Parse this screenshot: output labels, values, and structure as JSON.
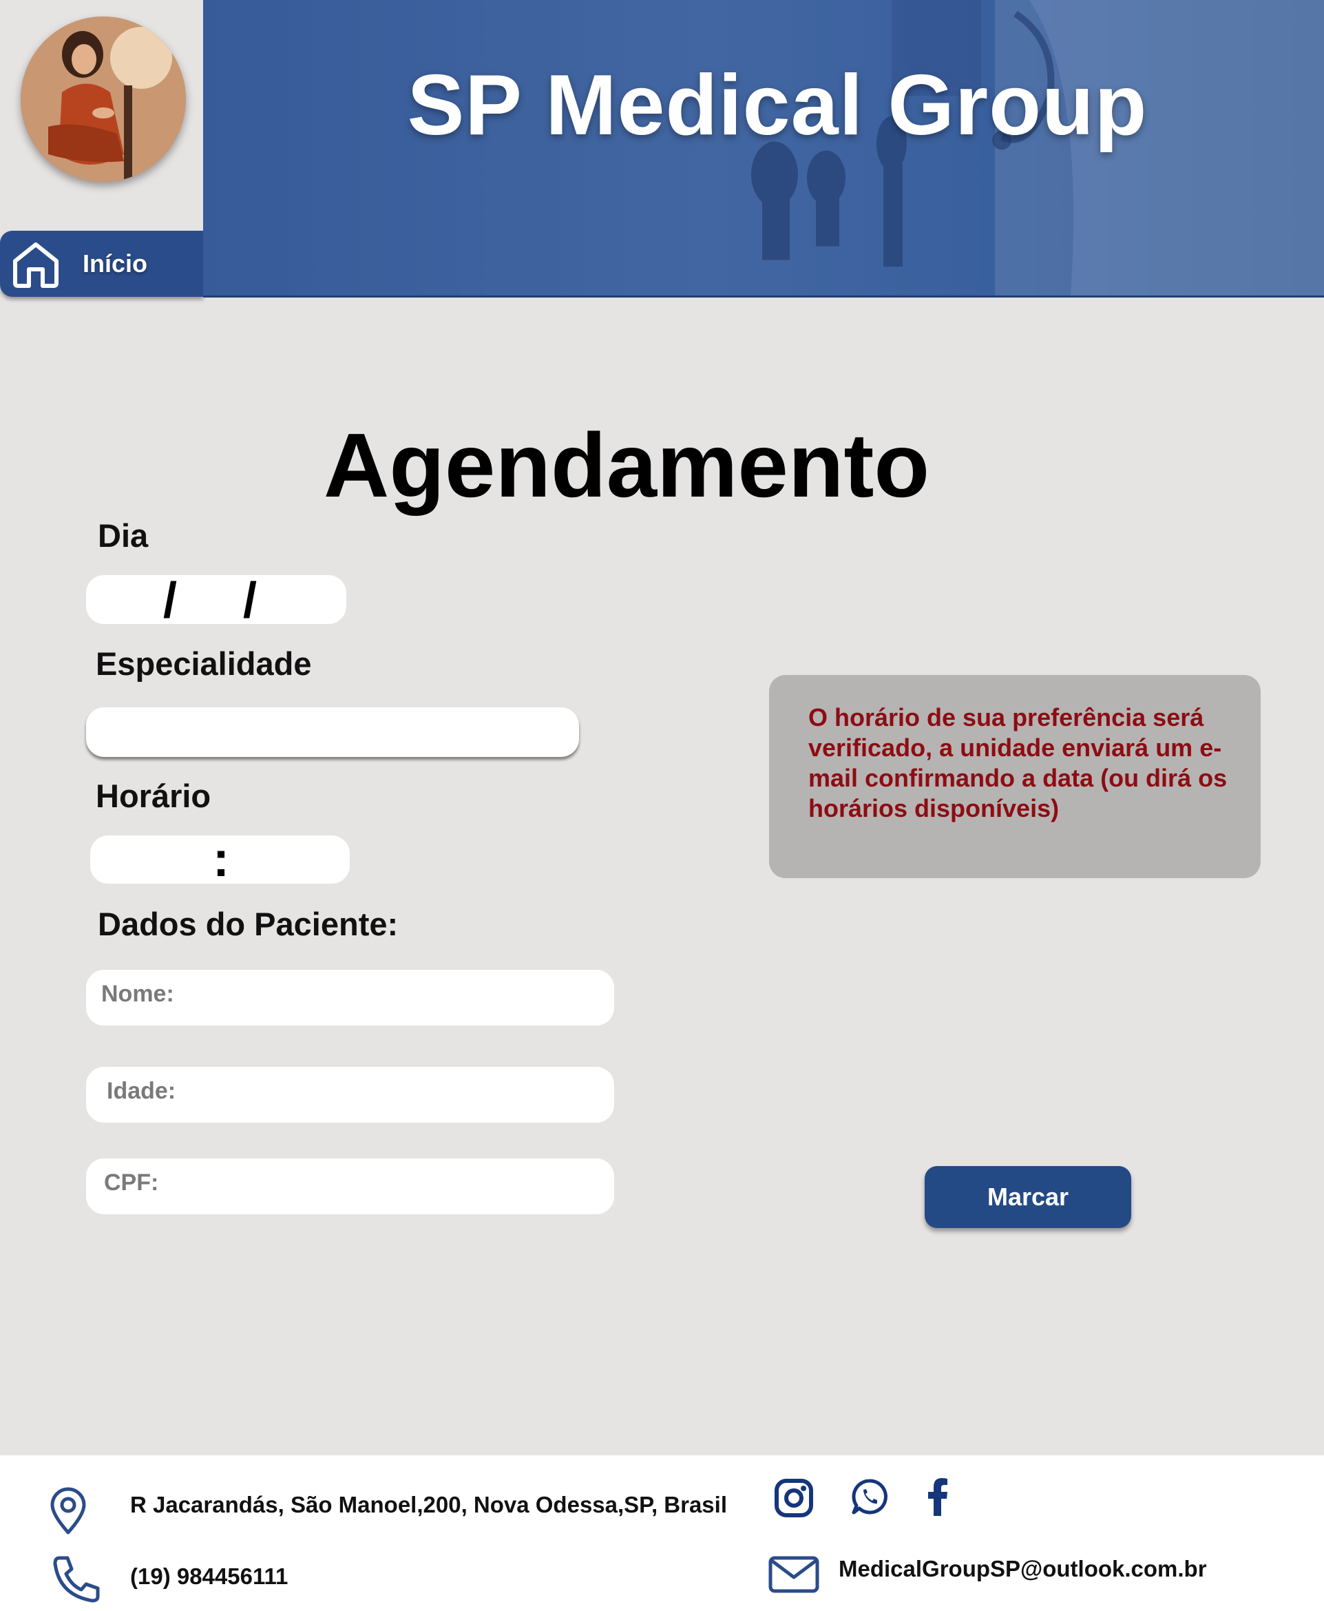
{
  "header": {
    "brand_title": "SP Medical Group",
    "home_label": "Início"
  },
  "main": {
    "title": "Agendamento",
    "day_label": "Dia",
    "date_separator": "/",
    "specialty_label": "Especialidade",
    "time_label": "Horário",
    "time_separator": ":",
    "patient_label": "Dados do Paciente:",
    "name_placeholder": "Nome:",
    "age_placeholder": "Idade:",
    "cpf_placeholder": "CPF:",
    "notice_text": "O horário de sua preferência será verificado, a unidade enviará um e-mail confirmando a data (ou dirá os horários disponíveis)",
    "submit_label": "Marcar"
  },
  "footer": {
    "address": "R Jacarandás, São Manoel,200, Nova Odessa,SP, Brasil",
    "phone": "(19) 984456111",
    "email": "MedicalGroupSP@outlook.com.br"
  },
  "colors": {
    "brand_blue": "#2b4c8a",
    "notice_text": "#8e0c12",
    "notice_bg": "#b5b4b3",
    "page_bg": "#e6e4e3"
  }
}
